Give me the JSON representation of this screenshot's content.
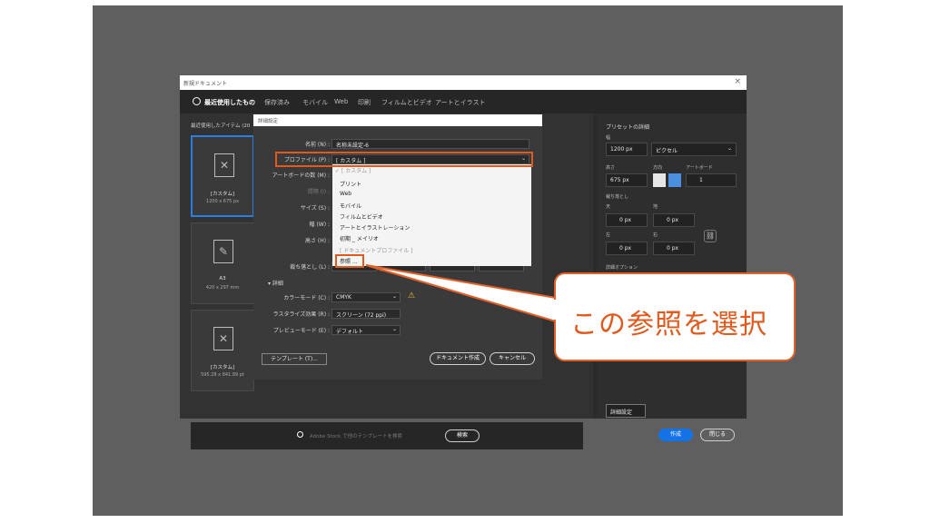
{
  "window": {
    "title": "新規ドキュメント",
    "close": "×"
  },
  "tabs": [
    "最近使用したもの",
    "保存済み",
    "モバイル",
    "Web",
    "印刷",
    "フィルムとビデオ",
    "アートとイラスト"
  ],
  "recent": {
    "label": "最近使用したアイテム (20",
    "cards": [
      {
        "name": "[カスタム]",
        "size": "1200 x 675 px"
      },
      {
        "name": "A3",
        "size": "420 x 297 mm"
      },
      {
        "name": "[カスタム]",
        "size": "595.28 x 841.89 pt"
      }
    ]
  },
  "search": {
    "placeholder": "Adobe Stock で他のテンプレートを検索",
    "button": "検索"
  },
  "preset": {
    "header": "プリセットの詳細",
    "width_label": "幅",
    "width_value": "1200 px",
    "unit": "ピクセル",
    "height_label": "高さ",
    "height_value": "675 px",
    "orientation_label": "方向",
    "artboard_label": "アートボード",
    "artboard_value": "1",
    "bleed_label": "裁ち落とし",
    "top_label": "天",
    "bottom_label": "地",
    "left_label": "左",
    "right_label": "右",
    "bleed_top": "0 px",
    "bleed_bottom": "0 px",
    "bleed_left": "0 px",
    "bleed_right": "0 px",
    "detail_options": "詳細オプション",
    "detail_button": "詳細設定",
    "create_button": "作成",
    "close_button": "閉じる"
  },
  "dialog": {
    "title": "詳細設定",
    "name_label": "名前 (N) :",
    "name_value": "名称未設定-6",
    "profile_label": "プロファイル (P) :",
    "profile_value": "[ カスタム ]",
    "artboards_label": "アートボードの数 (M) :",
    "spacing_label": "間隔 (I) :",
    "size_label": "サイズ (S) :",
    "width_label": "幅 (W) :",
    "height_label": "高さ (H) :",
    "bleed_label": "裁ち落とし (L) :",
    "advanced_label": "詳細",
    "color_mode_label": "カラーモード (C) :",
    "color_mode_value": "CMYK",
    "raster_label": "ラスタライズ効果 (R) :",
    "raster_value": "スクリーン (72 ppi)",
    "preview_label": "プレビューモード (E) :",
    "preview_value": "デフォルト",
    "template_button": "テンプレート (T)...",
    "create_button": "ドキュメント作成",
    "cancel_button": "キャンセル"
  },
  "dropdown": {
    "current": "✓ [ カスタム ]",
    "items": [
      "プリント",
      "Web",
      "モバイル",
      "フィルムとビデオ",
      "アートとイラストレーション",
      "初期 _ メイリオ"
    ],
    "section": "[ ドキュメントプロファイル ]",
    "browse": "参照 ..."
  },
  "callout": {
    "text": "この参照を選択"
  },
  "colors": {
    "accent": "#1473e6",
    "highlight": "#e05a1e",
    "panel": "#2b2b2b"
  }
}
